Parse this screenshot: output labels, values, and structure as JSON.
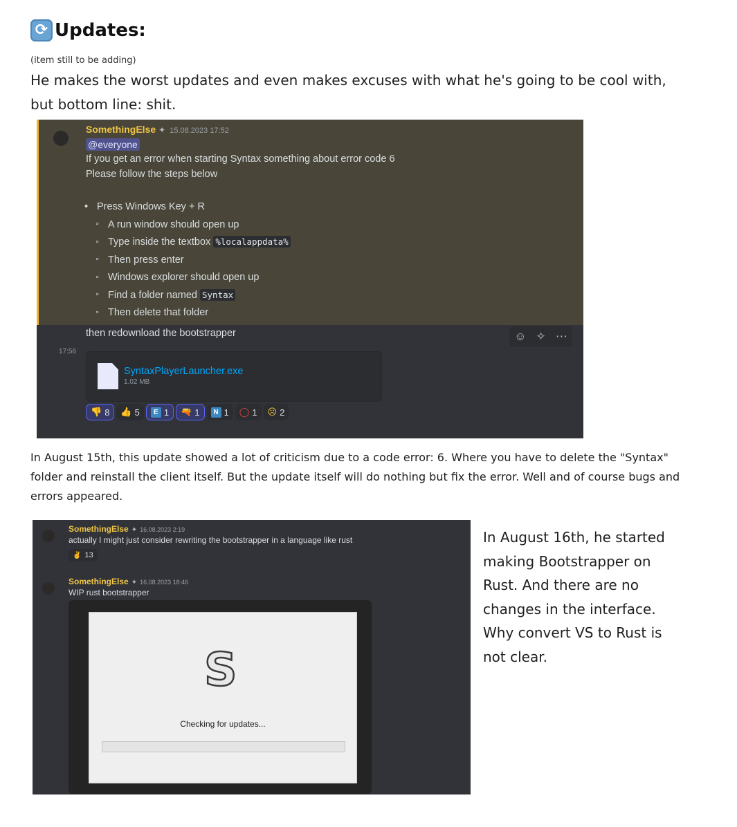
{
  "heading": {
    "title": "Updates:",
    "icon": "arrows-counterclockwise-icon"
  },
  "note": "(item still to be adding)",
  "intro": "He makes the worst updates and even makes excuses with what he's going to be cool with, but bottom line: shit.",
  "shot1": {
    "author": "SomethingElse",
    "timestamp": "15.08.2023 17:52",
    "mention": "@everyone",
    "line1": "If you get an error when starting Syntax something about error code 6",
    "line2": "Please follow the steps below",
    "bullet_main": "Press Windows Key + R",
    "sub1": "A run window should open up",
    "sub2_prefix": "Type inside the textbox",
    "sub2_code": "%localappdata%",
    "sub3": "Then press enter",
    "sub4": "Windows explorer should open up",
    "sub5_prefix": "Find a folder named",
    "sub5_code": "Syntax",
    "sub6": "Then delete that folder",
    "line_after": "then redownload the bootstrapper",
    "side_time": "17:56",
    "attachment": {
      "name": "SyntaxPlayerLauncher.exe",
      "size": "1.02 MB"
    },
    "reactions": [
      {
        "emoji": "👎",
        "count": "8",
        "me": true
      },
      {
        "emoji": "👍",
        "count": "5",
        "me": false
      },
      {
        "emoji": "E",
        "count": "1",
        "me": true
      },
      {
        "emoji": "🔫",
        "count": "1",
        "me": true
      },
      {
        "emoji": "N",
        "count": "1",
        "me": false
      },
      {
        "emoji": "⭕",
        "count": "1",
        "me": false
      },
      {
        "emoji": "☹",
        "count": "2",
        "me": false
      }
    ]
  },
  "para1": "In August 15th, this update showed a lot of criticism due to a code error: 6. Where you have to delete the \"Syntax\" folder and reinstall the client itself. But the update itself will do nothing but fix the error. Well and of course bugs and errors appeared.",
  "shot2": {
    "msg1": {
      "author": "SomethingElse",
      "timestamp": "16.08.2023 2:19",
      "text": "actually I might just consider rewriting the bootstrapper in a language like rust",
      "reaction_count": "13"
    },
    "msg2": {
      "author": "SomethingElse",
      "timestamp": "16.08.2023 18:46",
      "text": "WIP rust bootstrapper"
    },
    "app": {
      "logo": "S",
      "status": "Checking for updates...",
      "progress": 0
    }
  },
  "para2": "In August 16th, he started making Bootstrapper on Rust. And there are no changes in the interface. Why convert VS to Rust is not clear."
}
